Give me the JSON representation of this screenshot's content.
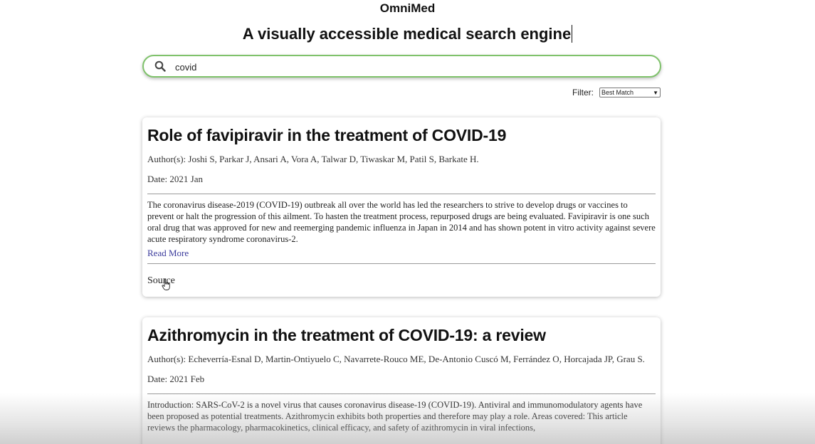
{
  "app": {
    "title": "OmniMed",
    "tagline": "A visually accessible medical search engine"
  },
  "search": {
    "value": "covid",
    "icon": "search-icon"
  },
  "filter": {
    "label": "Filter:",
    "selected": "Best Match"
  },
  "results": [
    {
      "title": "Role of favipiravir in the treatment of COVID-19",
      "authors": "Author(s): Joshi S, Parkar J, Ansari A, Vora A, Talwar D, Tiwaskar M, Patil S, Barkate H.",
      "date": "Date: 2021 Jan",
      "abstract": "The coronavirus disease-2019 (COVID-19) outbreak all over the world has led the researchers to strive to develop drugs or vaccines to prevent or halt the progression of this ailment. To hasten the treatment process, repurposed drugs are being evaluated. Favipiravir is one such oral drug that was approved for new and reemerging pandemic influenza in Japan in 2014 and has shown potent in vitro activity against severe acute respiratory syndrome coronavirus-2.",
      "read_more": "Read More",
      "source": "Source"
    },
    {
      "title": "Azithromycin in the treatment of COVID-19: a review",
      "authors": "Author(s): Echeverría-Esnal D, Martin-Ontiyuelo C, Navarrete-Rouco ME, De-Antonio Cuscó M, Ferrández O, Horcajada JP, Grau S.",
      "date": "Date: 2021 Feb",
      "abstract": "Introduction: SARS-CoV-2 is a novel virus that causes coronavirus disease-19 (COVID-19). Antiviral and immunomodulatory agents have been proposed as potential treatments. Azithromycin exhibits both properties and therefore may play a role. Areas covered: This article reviews the pharmacology, pharmacokinetics, clinical efficacy, and safety of azithromycin in viral infections,"
    }
  ],
  "colors": {
    "search_border": "#7fc26b",
    "link": "#3b3b9c"
  }
}
